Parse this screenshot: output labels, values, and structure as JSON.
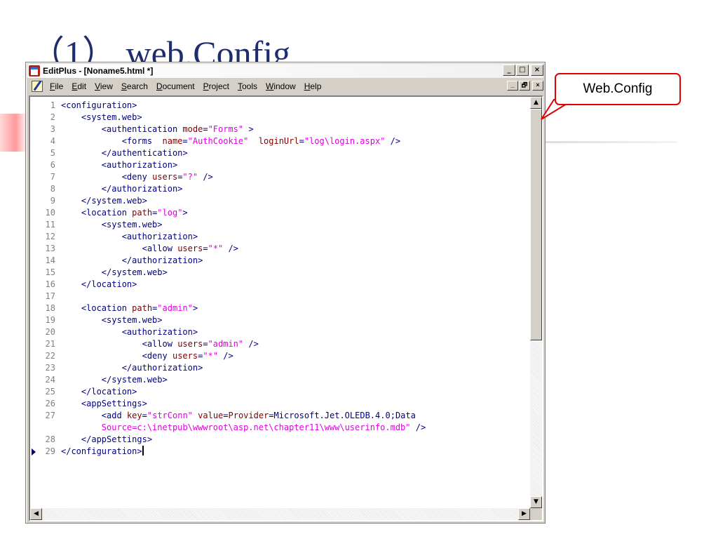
{
  "slide": {
    "title": "（1） web.Config"
  },
  "window": {
    "title": "EditPlus - [Noname5.html *]",
    "caption_buttons": [
      "_",
      "□",
      "×"
    ],
    "mdi_buttons": [
      "_",
      "🗗",
      "×"
    ]
  },
  "menu": [
    "File",
    "Edit",
    "View",
    "Search",
    "Document",
    "Project",
    "Tools",
    "Window",
    "Help"
  ],
  "editor": {
    "current_line": "29",
    "lines": [
      {
        "n": "1",
        "text": "<configuration>"
      },
      {
        "n": "2",
        "text": "    <system.web>"
      },
      {
        "n": "3",
        "text": "        <authentication mode=\"Forms\" >"
      },
      {
        "n": "4",
        "text": "            <forms  name=\"AuthCookie\"  loginUrl=\"log\\login.aspx\" />"
      },
      {
        "n": "5",
        "text": "        </authentication>"
      },
      {
        "n": "6",
        "text": "        <authorization>"
      },
      {
        "n": "7",
        "text": "            <deny users=\"?\" />"
      },
      {
        "n": "8",
        "text": "        </authorization>"
      },
      {
        "n": "9",
        "text": "    </system.web>"
      },
      {
        "n": "10",
        "text": "    <location path=\"log\">"
      },
      {
        "n": "11",
        "text": "        <system.web>"
      },
      {
        "n": "12",
        "text": "            <authorization>"
      },
      {
        "n": "13",
        "text": "                <allow users=\"*\" />"
      },
      {
        "n": "14",
        "text": "            </authorization>"
      },
      {
        "n": "15",
        "text": "        </system.web>"
      },
      {
        "n": "16",
        "text": "    </location>"
      },
      {
        "n": "17",
        "text": ""
      },
      {
        "n": "18",
        "text": "    <location path=\"admin\">"
      },
      {
        "n": "19",
        "text": "        <system.web>"
      },
      {
        "n": "20",
        "text": "            <authorization>"
      },
      {
        "n": "21",
        "text": "                <allow users=\"admin\" />"
      },
      {
        "n": "22",
        "text": "                <deny users=\"*\" />"
      },
      {
        "n": "23",
        "text": "            </authorization>"
      },
      {
        "n": "24",
        "text": "        </system.web>"
      },
      {
        "n": "25",
        "text": "    </location>"
      },
      {
        "n": "26",
        "text": "    <appSettings>"
      },
      {
        "n": "27",
        "text": "        <add key=\"strConn\" value=\"Provider=Microsoft.Jet.OLEDB.4.0;Data"
      },
      {
        "n": "",
        "text": "        Source=c:\\inetpub\\wwwroot\\asp.net\\chapter11\\www\\userinfo.mdb\" />"
      },
      {
        "n": "28",
        "text": "    </appSettings>"
      },
      {
        "n": "29",
        "text": "</configuration>"
      }
    ]
  },
  "callout": {
    "label": "Web.Config"
  },
  "colors": {
    "tag": "#000080",
    "attribute": "#800000",
    "string": "#e000e0",
    "line_number": "#808080",
    "callout_border": "#e00000",
    "title": "#1f2c6e"
  }
}
